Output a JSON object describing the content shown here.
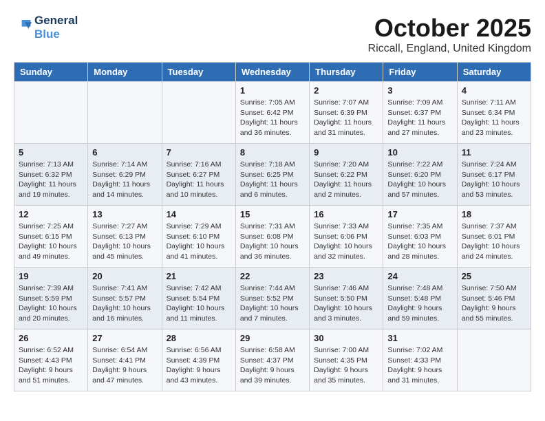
{
  "header": {
    "logo_line1": "General",
    "logo_line2": "Blue",
    "month": "October 2025",
    "location": "Riccall, England, United Kingdom"
  },
  "weekdays": [
    "Sunday",
    "Monday",
    "Tuesday",
    "Wednesday",
    "Thursday",
    "Friday",
    "Saturday"
  ],
  "weeks": [
    [
      {
        "day": "",
        "info": ""
      },
      {
        "day": "",
        "info": ""
      },
      {
        "day": "",
        "info": ""
      },
      {
        "day": "1",
        "info": "Sunrise: 7:05 AM\nSunset: 6:42 PM\nDaylight: 11 hours\nand 36 minutes."
      },
      {
        "day": "2",
        "info": "Sunrise: 7:07 AM\nSunset: 6:39 PM\nDaylight: 11 hours\nand 31 minutes."
      },
      {
        "day": "3",
        "info": "Sunrise: 7:09 AM\nSunset: 6:37 PM\nDaylight: 11 hours\nand 27 minutes."
      },
      {
        "day": "4",
        "info": "Sunrise: 7:11 AM\nSunset: 6:34 PM\nDaylight: 11 hours\nand 23 minutes."
      }
    ],
    [
      {
        "day": "5",
        "info": "Sunrise: 7:13 AM\nSunset: 6:32 PM\nDaylight: 11 hours\nand 19 minutes."
      },
      {
        "day": "6",
        "info": "Sunrise: 7:14 AM\nSunset: 6:29 PM\nDaylight: 11 hours\nand 14 minutes."
      },
      {
        "day": "7",
        "info": "Sunrise: 7:16 AM\nSunset: 6:27 PM\nDaylight: 11 hours\nand 10 minutes."
      },
      {
        "day": "8",
        "info": "Sunrise: 7:18 AM\nSunset: 6:25 PM\nDaylight: 11 hours\nand 6 minutes."
      },
      {
        "day": "9",
        "info": "Sunrise: 7:20 AM\nSunset: 6:22 PM\nDaylight: 11 hours\nand 2 minutes."
      },
      {
        "day": "10",
        "info": "Sunrise: 7:22 AM\nSunset: 6:20 PM\nDaylight: 10 hours\nand 57 minutes."
      },
      {
        "day": "11",
        "info": "Sunrise: 7:24 AM\nSunset: 6:17 PM\nDaylight: 10 hours\nand 53 minutes."
      }
    ],
    [
      {
        "day": "12",
        "info": "Sunrise: 7:25 AM\nSunset: 6:15 PM\nDaylight: 10 hours\nand 49 minutes."
      },
      {
        "day": "13",
        "info": "Sunrise: 7:27 AM\nSunset: 6:13 PM\nDaylight: 10 hours\nand 45 minutes."
      },
      {
        "day": "14",
        "info": "Sunrise: 7:29 AM\nSunset: 6:10 PM\nDaylight: 10 hours\nand 41 minutes."
      },
      {
        "day": "15",
        "info": "Sunrise: 7:31 AM\nSunset: 6:08 PM\nDaylight: 10 hours\nand 36 minutes."
      },
      {
        "day": "16",
        "info": "Sunrise: 7:33 AM\nSunset: 6:06 PM\nDaylight: 10 hours\nand 32 minutes."
      },
      {
        "day": "17",
        "info": "Sunrise: 7:35 AM\nSunset: 6:03 PM\nDaylight: 10 hours\nand 28 minutes."
      },
      {
        "day": "18",
        "info": "Sunrise: 7:37 AM\nSunset: 6:01 PM\nDaylight: 10 hours\nand 24 minutes."
      }
    ],
    [
      {
        "day": "19",
        "info": "Sunrise: 7:39 AM\nSunset: 5:59 PM\nDaylight: 10 hours\nand 20 minutes."
      },
      {
        "day": "20",
        "info": "Sunrise: 7:41 AM\nSunset: 5:57 PM\nDaylight: 10 hours\nand 16 minutes."
      },
      {
        "day": "21",
        "info": "Sunrise: 7:42 AM\nSunset: 5:54 PM\nDaylight: 10 hours\nand 11 minutes."
      },
      {
        "day": "22",
        "info": "Sunrise: 7:44 AM\nSunset: 5:52 PM\nDaylight: 10 hours\nand 7 minutes."
      },
      {
        "day": "23",
        "info": "Sunrise: 7:46 AM\nSunset: 5:50 PM\nDaylight: 10 hours\nand 3 minutes."
      },
      {
        "day": "24",
        "info": "Sunrise: 7:48 AM\nSunset: 5:48 PM\nDaylight: 9 hours\nand 59 minutes."
      },
      {
        "day": "25",
        "info": "Sunrise: 7:50 AM\nSunset: 5:46 PM\nDaylight: 9 hours\nand 55 minutes."
      }
    ],
    [
      {
        "day": "26",
        "info": "Sunrise: 6:52 AM\nSunset: 4:43 PM\nDaylight: 9 hours\nand 51 minutes."
      },
      {
        "day": "27",
        "info": "Sunrise: 6:54 AM\nSunset: 4:41 PM\nDaylight: 9 hours\nand 47 minutes."
      },
      {
        "day": "28",
        "info": "Sunrise: 6:56 AM\nSunset: 4:39 PM\nDaylight: 9 hours\nand 43 minutes."
      },
      {
        "day": "29",
        "info": "Sunrise: 6:58 AM\nSunset: 4:37 PM\nDaylight: 9 hours\nand 39 minutes."
      },
      {
        "day": "30",
        "info": "Sunrise: 7:00 AM\nSunset: 4:35 PM\nDaylight: 9 hours\nand 35 minutes."
      },
      {
        "day": "31",
        "info": "Sunrise: 7:02 AM\nSunset: 4:33 PM\nDaylight: 9 hours\nand 31 minutes."
      },
      {
        "day": "",
        "info": ""
      }
    ]
  ]
}
